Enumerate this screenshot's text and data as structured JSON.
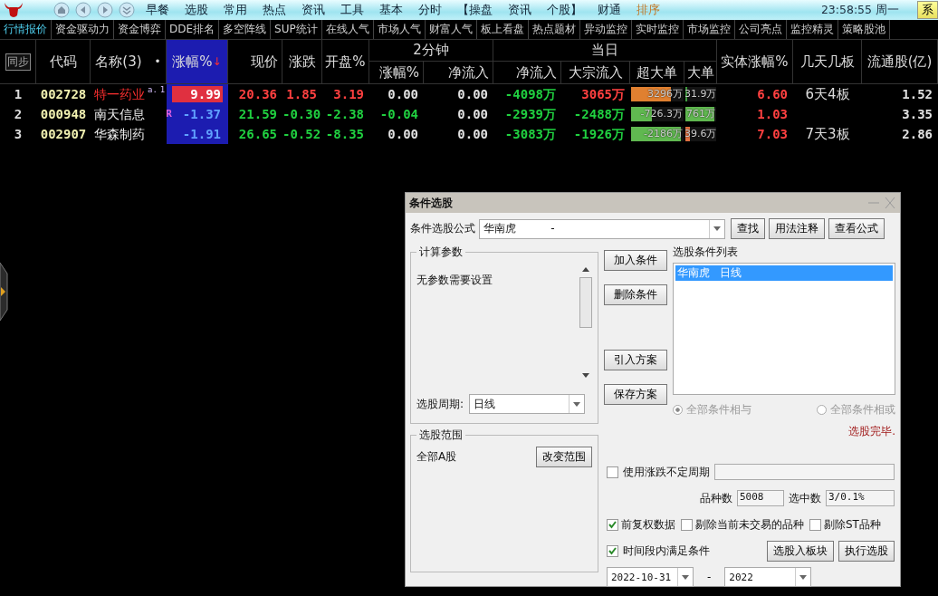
{
  "menu": {
    "items": [
      {
        "label": "早餐",
        "disabled": false
      },
      {
        "label": "选股",
        "disabled": false
      },
      {
        "label": "常用",
        "disabled": false
      },
      {
        "label": "热点",
        "disabled": false
      },
      {
        "label": "资讯",
        "disabled": false
      },
      {
        "label": "工具",
        "disabled": false
      },
      {
        "label": "基本",
        "disabled": false
      },
      {
        "label": "分时",
        "disabled": false
      },
      {
        "label": "【操盘",
        "disabled": false
      },
      {
        "label": "资讯",
        "disabled": false
      },
      {
        "label": "个股】",
        "disabled": false
      },
      {
        "label": "财通",
        "disabled": false
      },
      {
        "label": "排序",
        "disabled": true
      }
    ],
    "clock": "23:58:55 周一",
    "system_button": "系"
  },
  "tabs": [
    {
      "label": "行情报价",
      "selected": true
    },
    {
      "label": "资金驱动力",
      "selected": false
    },
    {
      "label": "资金博弈",
      "selected": false
    },
    {
      "label": "DDE排名",
      "selected": false
    },
    {
      "label": "多空阵线",
      "selected": false
    },
    {
      "label": "SUP统计",
      "selected": false
    },
    {
      "label": "在线人气",
      "selected": false
    },
    {
      "label": "市场人气",
      "selected": false
    },
    {
      "label": "财富人气",
      "selected": false
    },
    {
      "label": "板上看盘",
      "selected": false
    },
    {
      "label": "热点题材",
      "selected": false
    },
    {
      "label": "异动监控",
      "selected": false
    },
    {
      "label": "实时监控",
      "selected": false
    },
    {
      "label": "市场监控",
      "selected": false
    },
    {
      "label": "公司亮点",
      "selected": false
    },
    {
      "label": "监控精灵",
      "selected": false
    },
    {
      "label": "策略股池",
      "selected": false
    }
  ],
  "table": {
    "sync_button": "同步",
    "columns": {
      "code": "代码",
      "name": "名称(3)",
      "name_dot": "•",
      "change": "涨幅%",
      "sort_arrow": "↓",
      "price": "现价",
      "delta": "涨跌",
      "open": "开盘%",
      "group_2min": "2分钟",
      "change_2min": "涨幅%",
      "inflow_2min": "净流入",
      "group_day": "当日",
      "inflow_day": "净流入",
      "block": "大宗流入",
      "xl": "超大单",
      "large": "大单",
      "body": "实体涨幅%",
      "boards": "几天几板",
      "float": "流通股(亿)"
    },
    "rows": [
      {
        "rank": "1",
        "code": "002728",
        "name": "特一药业",
        "name_up": true,
        "tags": [
          "a.",
          "1"
        ],
        "flag": "",
        "change": {
          "text": "9.99",
          "limit": true
        },
        "price": {
          "text": "20.36",
          "color": "#ff4040"
        },
        "delta": {
          "text": "1.85",
          "color": "#ff4040"
        },
        "open": {
          "text": "3.19",
          "color": "#ff4040"
        },
        "change_2min": {
          "text": "0.00",
          "color": "#e0e0e0"
        },
        "inflow_2min": "0.00",
        "inflow_day": {
          "text": "-4098万",
          "color": "#20d040"
        },
        "block": {
          "text": "3065万",
          "color": "#ff4040"
        },
        "xl": {
          "text": "3296万",
          "color": "#e08030",
          "level": 0.75
        },
        "large": {
          "text": "31.9万",
          "color": "#40a040",
          "level": 0.05
        },
        "body": {
          "text": "6.60",
          "color": "#ff4040"
        },
        "boards": "6天4板",
        "float": "1.52"
      },
      {
        "rank": "2",
        "code": "000948",
        "name": "南天信息",
        "name_up": false,
        "tags": [],
        "flag": "R",
        "change": {
          "text": "-1.37",
          "limit": false
        },
        "price": {
          "text": "21.59",
          "color": "#20d040"
        },
        "delta": {
          "text": "-0.30",
          "color": "#20d040"
        },
        "open": {
          "text": "-2.38",
          "color": "#20d040"
        },
        "change_2min": {
          "text": "-0.04",
          "color": "#20d040"
        },
        "inflow_2min": "0.00",
        "inflow_day": {
          "text": "-2939万",
          "color": "#20d040"
        },
        "block": {
          "text": "-2488万",
          "color": "#20d040"
        },
        "xl": {
          "text": "-726.3万",
          "color": "#60b850",
          "level": 0.4
        },
        "large": {
          "text": "761万",
          "color": "#60b850",
          "level": 0.95
        },
        "body": {
          "text": "1.03",
          "color": "#ff4040"
        },
        "boards": "",
        "float": "3.35"
      },
      {
        "rank": "3",
        "code": "002907",
        "name": "华森制药",
        "name_up": false,
        "tags": [],
        "flag": "",
        "change": {
          "text": "-1.91",
          "limit": false
        },
        "price": {
          "text": "26.65",
          "color": "#20d040"
        },
        "delta": {
          "text": "-0.52",
          "color": "#20d040"
        },
        "open": {
          "text": "-8.35",
          "color": "#20d040"
        },
        "change_2min": {
          "text": "0.00",
          "color": "#e0e0e0"
        },
        "inflow_2min": "0.00",
        "inflow_day": {
          "text": "-3083万",
          "color": "#20d040"
        },
        "block": {
          "text": "-1926万",
          "color": "#20d040"
        },
        "xl": {
          "text": "-2186万",
          "color": "#60b850",
          "level": 0.95
        },
        "large": {
          "text": "39.6万",
          "color": "#e07040",
          "level": 0.15
        },
        "body": {
          "text": "7.03",
          "color": "#ff4040"
        },
        "boards": "7天3板",
        "float": "2.86"
      }
    ]
  },
  "dialog": {
    "title": "条件选股",
    "formula_label": "条件选股公式",
    "formula_value": "华南虎          -",
    "find_button": "查找",
    "usage_button": "用法注释",
    "view_button": "查看公式",
    "params_title": "计算参数",
    "params_text": "无参数需要设置",
    "add_button": "加入条件",
    "delete_button": "删除条件",
    "import_button": "引入方案",
    "save_button": "保存方案",
    "conditions_title": "选股条件列表",
    "conditions": [
      {
        "label": "华南虎   日线",
        "selected": true
      }
    ],
    "period_label": "选股周期:",
    "period_value": "日线",
    "logic": [
      {
        "label": "全部条件相与",
        "selected": true
      },
      {
        "label": "全部条件相或",
        "selected": false
      }
    ],
    "status": "选股完毕.",
    "range_title": "选股范围",
    "range_value": "全部A股",
    "range_button": "改变范围",
    "variable_period": {
      "label": "使用涨跌不定周期",
      "checked": false
    },
    "count_label": "品种数",
    "count_value": "5008",
    "picked_label": "选中数",
    "picked_value": "3/0.1%",
    "options": [
      {
        "label": "前复权数据",
        "checked": true
      },
      {
        "label": "剔除当前未交易的品种",
        "checked": false
      },
      {
        "label": "剔除ST品种",
        "checked": false
      }
    ],
    "timespan": {
      "label": "时间段内满足条件",
      "checked": true
    },
    "to_block_button": "选股入板块",
    "run_button": "执行选股",
    "date_from": "2022-10-31",
    "date_sep": "-",
    "date_to": "2022"
  }
}
